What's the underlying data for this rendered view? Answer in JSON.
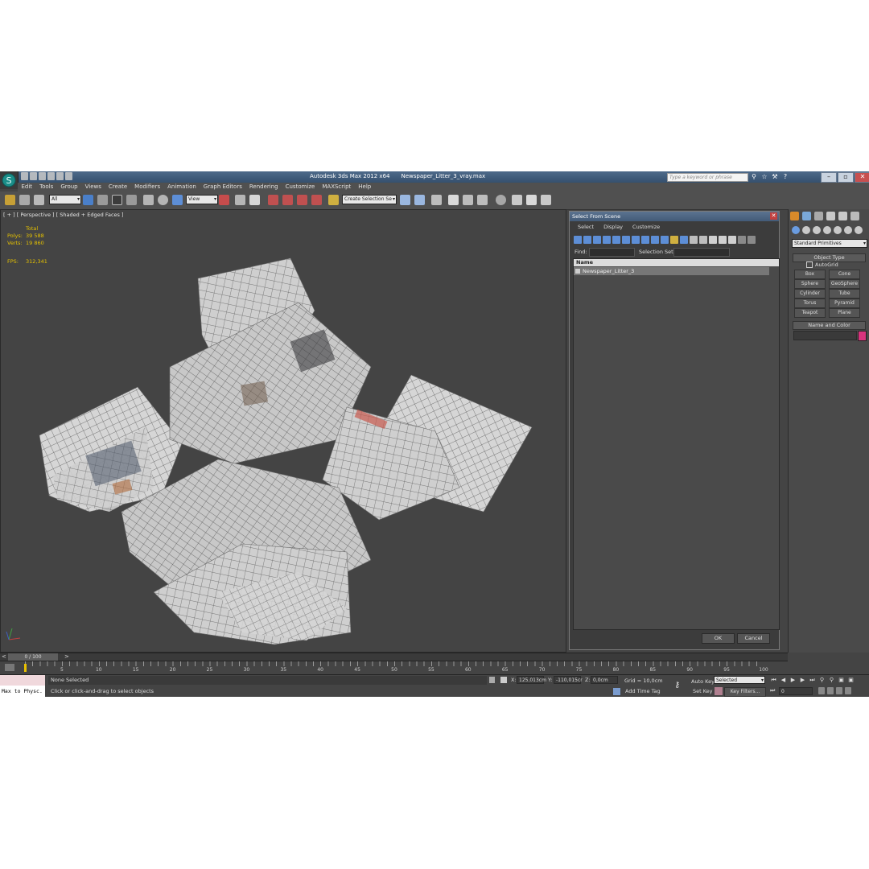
{
  "window": {
    "app_title": "Autodesk 3ds Max  2012 x64",
    "file_name": "Newspaper_Litter_3_vray.max",
    "search_placeholder": "Type a keyword or phrase"
  },
  "menu": [
    "Edit",
    "Tools",
    "Group",
    "Views",
    "Create",
    "Modifiers",
    "Animation",
    "Graph Editors",
    "Rendering",
    "Customize",
    "MAXScript",
    "Help"
  ],
  "toolbar": {
    "filter_value": "All",
    "refcoord_value": "View",
    "selection_set_value": "Create Selection Se"
  },
  "viewport": {
    "label": "[ + ] [ Perspective ] [ Shaded + Edged Faces ]",
    "stats": {
      "total_label": "Total",
      "polys_label": "Polys:",
      "polys_value": "39 588",
      "verts_label": "Verts:",
      "verts_value": "19 860",
      "fps_label": "FPS:",
      "fps_value": "312,341"
    }
  },
  "select_dialog": {
    "title": "Select From Scene",
    "menu": [
      "Select",
      "Display",
      "Customize"
    ],
    "find_label": "Find:",
    "selection_set_label": "Selection Set:",
    "column_name": "Name",
    "items": [
      "Newspaper_Litter_3"
    ],
    "ok_label": "OK",
    "cancel_label": "Cancel"
  },
  "command_panel": {
    "category": "Standard Primitives",
    "object_type_title": "Object Type",
    "autogrid_label": "AutoGrid",
    "object_buttons": [
      "Box",
      "Cone",
      "Sphere",
      "GeoSphere",
      "Cylinder",
      "Tube",
      "Torus",
      "Pyramid",
      "Teapot",
      "Plane"
    ],
    "name_color_title": "Name and Color",
    "object_color": "#d8347d"
  },
  "timeline": {
    "slider_label": "0 / 100",
    "tick_labels": [
      "5",
      "10",
      "15",
      "20",
      "25",
      "30",
      "35",
      "40",
      "45",
      "50",
      "55",
      "60",
      "65",
      "70",
      "75",
      "80",
      "85",
      "90",
      "95",
      "100"
    ]
  },
  "status": {
    "maxscript_label": "Max to Physc.",
    "selection_status": "None Selected",
    "prompt": "Click or click-and-drag to select objects",
    "x_label": "X:",
    "x_value": "125,013cm",
    "y_label": "Y:",
    "y_value": "-110,015cr",
    "z_label": "Z:",
    "z_value": "0,0cm",
    "grid": "Grid = 10,0cm",
    "add_time_tag": "Add Time Tag",
    "auto_key": "Auto Key",
    "set_key": "Set Key",
    "selected_value": "Selected",
    "key_filters": "Key Filters...",
    "frame_value": "0"
  }
}
